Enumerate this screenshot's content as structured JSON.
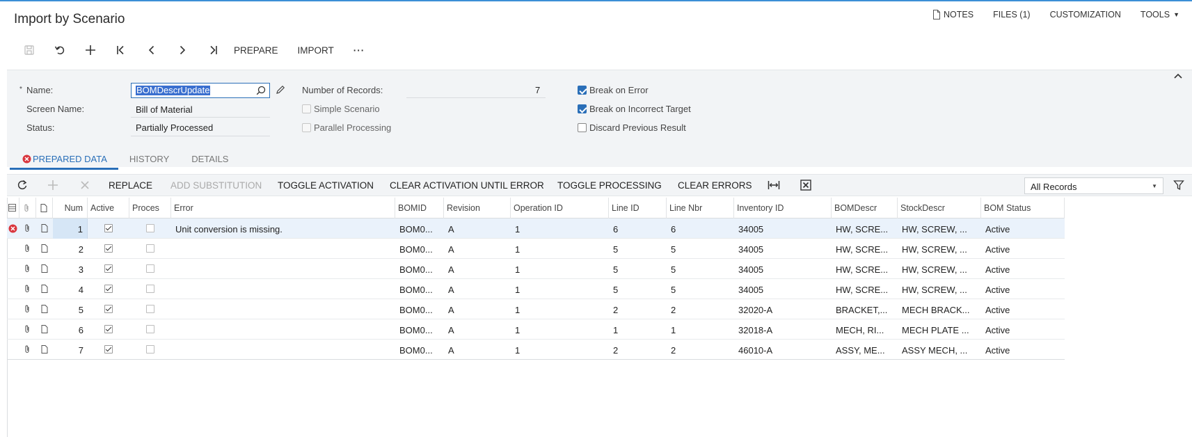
{
  "app": {
    "title": "Import by Scenario"
  },
  "top_links": {
    "notes": "NOTES",
    "files": "FILES (1)",
    "customization": "CUSTOMIZATION",
    "tools": "TOOLS"
  },
  "main_toolbar": {
    "prepare": "PREPARE",
    "import": "IMPORT",
    "more": "···"
  },
  "form": {
    "name_label": "Name:",
    "name_required_mark": "*",
    "name_value": "BOMDescrUpdate",
    "screen_name_label": "Screen Name:",
    "screen_name_value": "Bill of Material",
    "status_label": "Status:",
    "status_value": "Partially Processed",
    "records_label": "Number of Records:",
    "records_value": "7",
    "simple_scenario": {
      "label": "Simple Scenario",
      "checked": false,
      "disabled": true
    },
    "parallel_processing": {
      "label": "Parallel Processing",
      "checked": false,
      "disabled": true
    },
    "break_on_error": {
      "label": "Break on Error",
      "checked": true
    },
    "break_on_incorrect_target": {
      "label": "Break on Incorrect Target",
      "checked": true
    },
    "discard_previous_result": {
      "label": "Discard Previous Result",
      "checked": false
    }
  },
  "tabs": [
    {
      "label": "PREPARED DATA",
      "active": true,
      "has_error": true
    },
    {
      "label": "HISTORY",
      "active": false
    },
    {
      "label": "DETAILS",
      "active": false
    }
  ],
  "grid_toolbar": {
    "replace": "REPLACE",
    "add_substitution": "ADD SUBSTITUTION",
    "toggle_activation": "TOGGLE ACTIVATION",
    "clear_activation_until_error": "CLEAR ACTIVATION UNTIL ERROR",
    "toggle_processing": "TOGGLE PROCESSING",
    "clear_errors": "CLEAR ERRORS",
    "records_filter": "All Records"
  },
  "grid": {
    "columns": [
      "Num",
      "Active",
      "Proces",
      "Error",
      "BOMID",
      "Revision",
      "Operation ID",
      "Line ID",
      "Line Nbr",
      "Inventory ID",
      "BOMDescr",
      "StockDescr",
      "BOM Status"
    ],
    "rows": [
      {
        "num": "1",
        "active": true,
        "processed": false,
        "error": "Unit conversion is missing.",
        "bomid": "BOM0...",
        "revision": "A",
        "operation_id": "1",
        "line_id": "6",
        "line_nbr": "6",
        "inventory_id": "34005",
        "bomdescr": "HW, SCRE...",
        "stockdescr": "HW, SCREW, ...",
        "bom_status": "Active",
        "has_error": true
      },
      {
        "num": "2",
        "active": true,
        "processed": false,
        "error": "",
        "bomid": "BOM0...",
        "revision": "A",
        "operation_id": "1",
        "line_id": "5",
        "line_nbr": "5",
        "inventory_id": "34005",
        "bomdescr": "HW, SCRE...",
        "stockdescr": "HW, SCREW, ...",
        "bom_status": "Active",
        "has_error": false
      },
      {
        "num": "3",
        "active": true,
        "processed": false,
        "error": "",
        "bomid": "BOM0...",
        "revision": "A",
        "operation_id": "1",
        "line_id": "5",
        "line_nbr": "5",
        "inventory_id": "34005",
        "bomdescr": "HW, SCRE...",
        "stockdescr": "HW, SCREW, ...",
        "bom_status": "Active",
        "has_error": false
      },
      {
        "num": "4",
        "active": true,
        "processed": false,
        "error": "",
        "bomid": "BOM0...",
        "revision": "A",
        "operation_id": "1",
        "line_id": "5",
        "line_nbr": "5",
        "inventory_id": "34005",
        "bomdescr": "HW, SCRE...",
        "stockdescr": "HW, SCREW, ...",
        "bom_status": "Active",
        "has_error": false
      },
      {
        "num": "5",
        "active": true,
        "processed": false,
        "error": "",
        "bomid": "BOM0...",
        "revision": "A",
        "operation_id": "1",
        "line_id": "2",
        "line_nbr": "2",
        "inventory_id": "32020-A",
        "bomdescr": "BRACKET,...",
        "stockdescr": "MECH BRACK...",
        "bom_status": "Active",
        "has_error": false
      },
      {
        "num": "6",
        "active": true,
        "processed": false,
        "error": "",
        "bomid": "BOM0...",
        "revision": "A",
        "operation_id": "1",
        "line_id": "1",
        "line_nbr": "1",
        "inventory_id": "32018-A",
        "bomdescr": "MECH, RI...",
        "stockdescr": "MECH PLATE ...",
        "bom_status": "Active",
        "has_error": false
      },
      {
        "num": "7",
        "active": true,
        "processed": false,
        "error": "",
        "bomid": "BOM0...",
        "revision": "A",
        "operation_id": "1",
        "line_id": "2",
        "line_nbr": "2",
        "inventory_id": "46010-A",
        "bomdescr": "ASSY, ME...",
        "stockdescr": "ASSY MECH, ...",
        "bom_status": "Active",
        "has_error": false
      }
    ]
  },
  "colors": {
    "accent": "#2a6fb8",
    "error": "#d9363e",
    "panel_bg": "#f2f4f6",
    "selected_row": "#eaf2fb"
  }
}
